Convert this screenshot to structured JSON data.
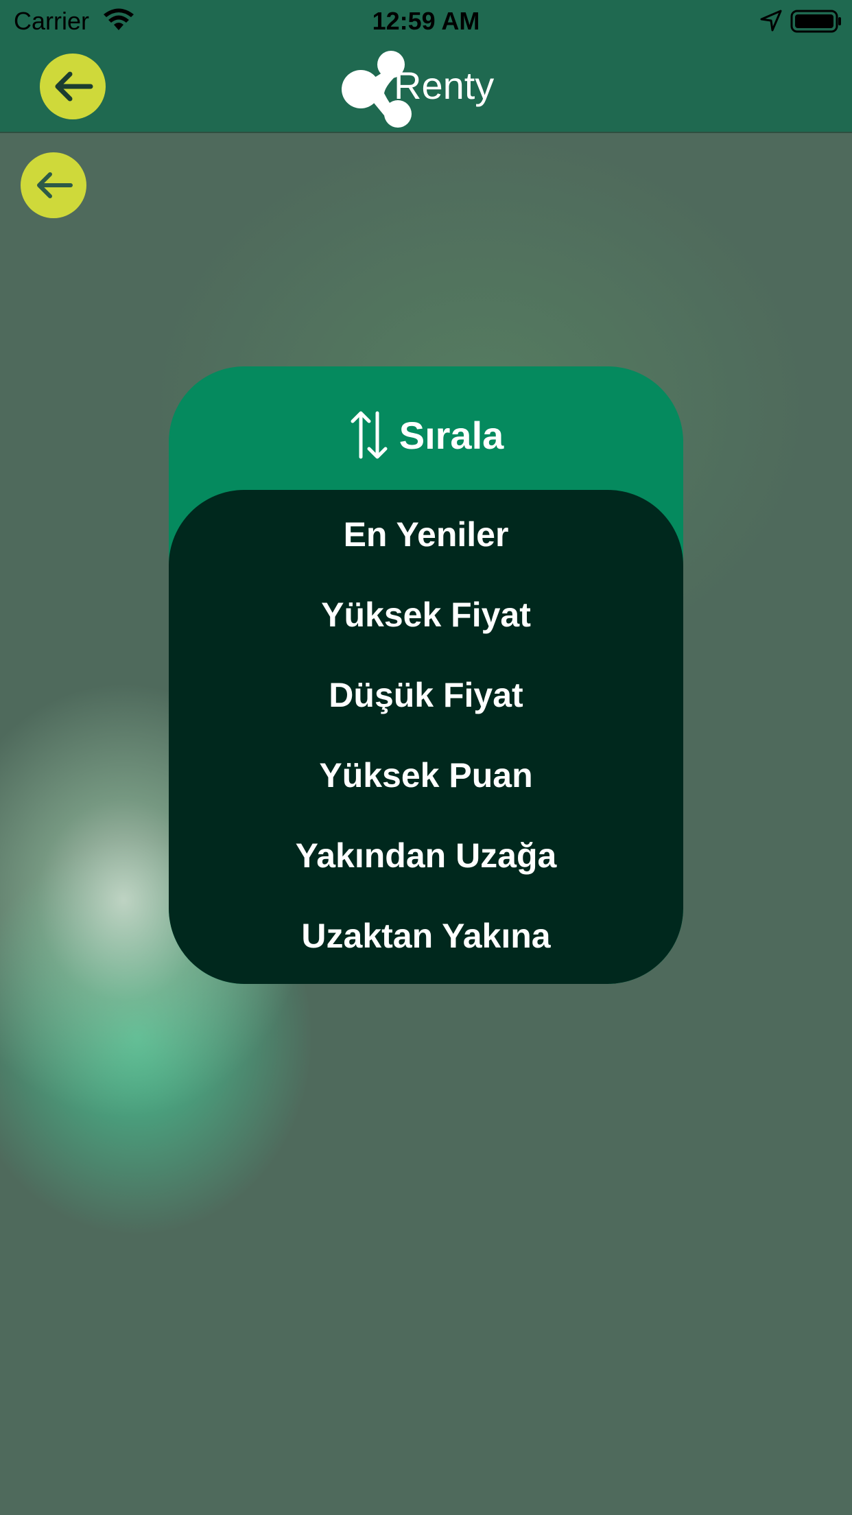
{
  "status_bar": {
    "carrier": "Carrier",
    "time": "12:59 AM"
  },
  "nav": {
    "logo_text": "Renty",
    "back_icon": "arrow-left-icon"
  },
  "sort_dialog": {
    "title": "Sırala",
    "icon": "sort-arrows-icon",
    "options": [
      "En Yeniler",
      "Yüksek Fiyat",
      "Düşük Fiyat",
      "Yüksek Puan",
      "Yakından Uzağa",
      "Uzaktan Yakına"
    ]
  },
  "colors": {
    "nav_green": "#1f6950",
    "accent_yellow": "#cfd93a",
    "dialog_green": "#058a5e",
    "dialog_dark": "#00281d"
  }
}
